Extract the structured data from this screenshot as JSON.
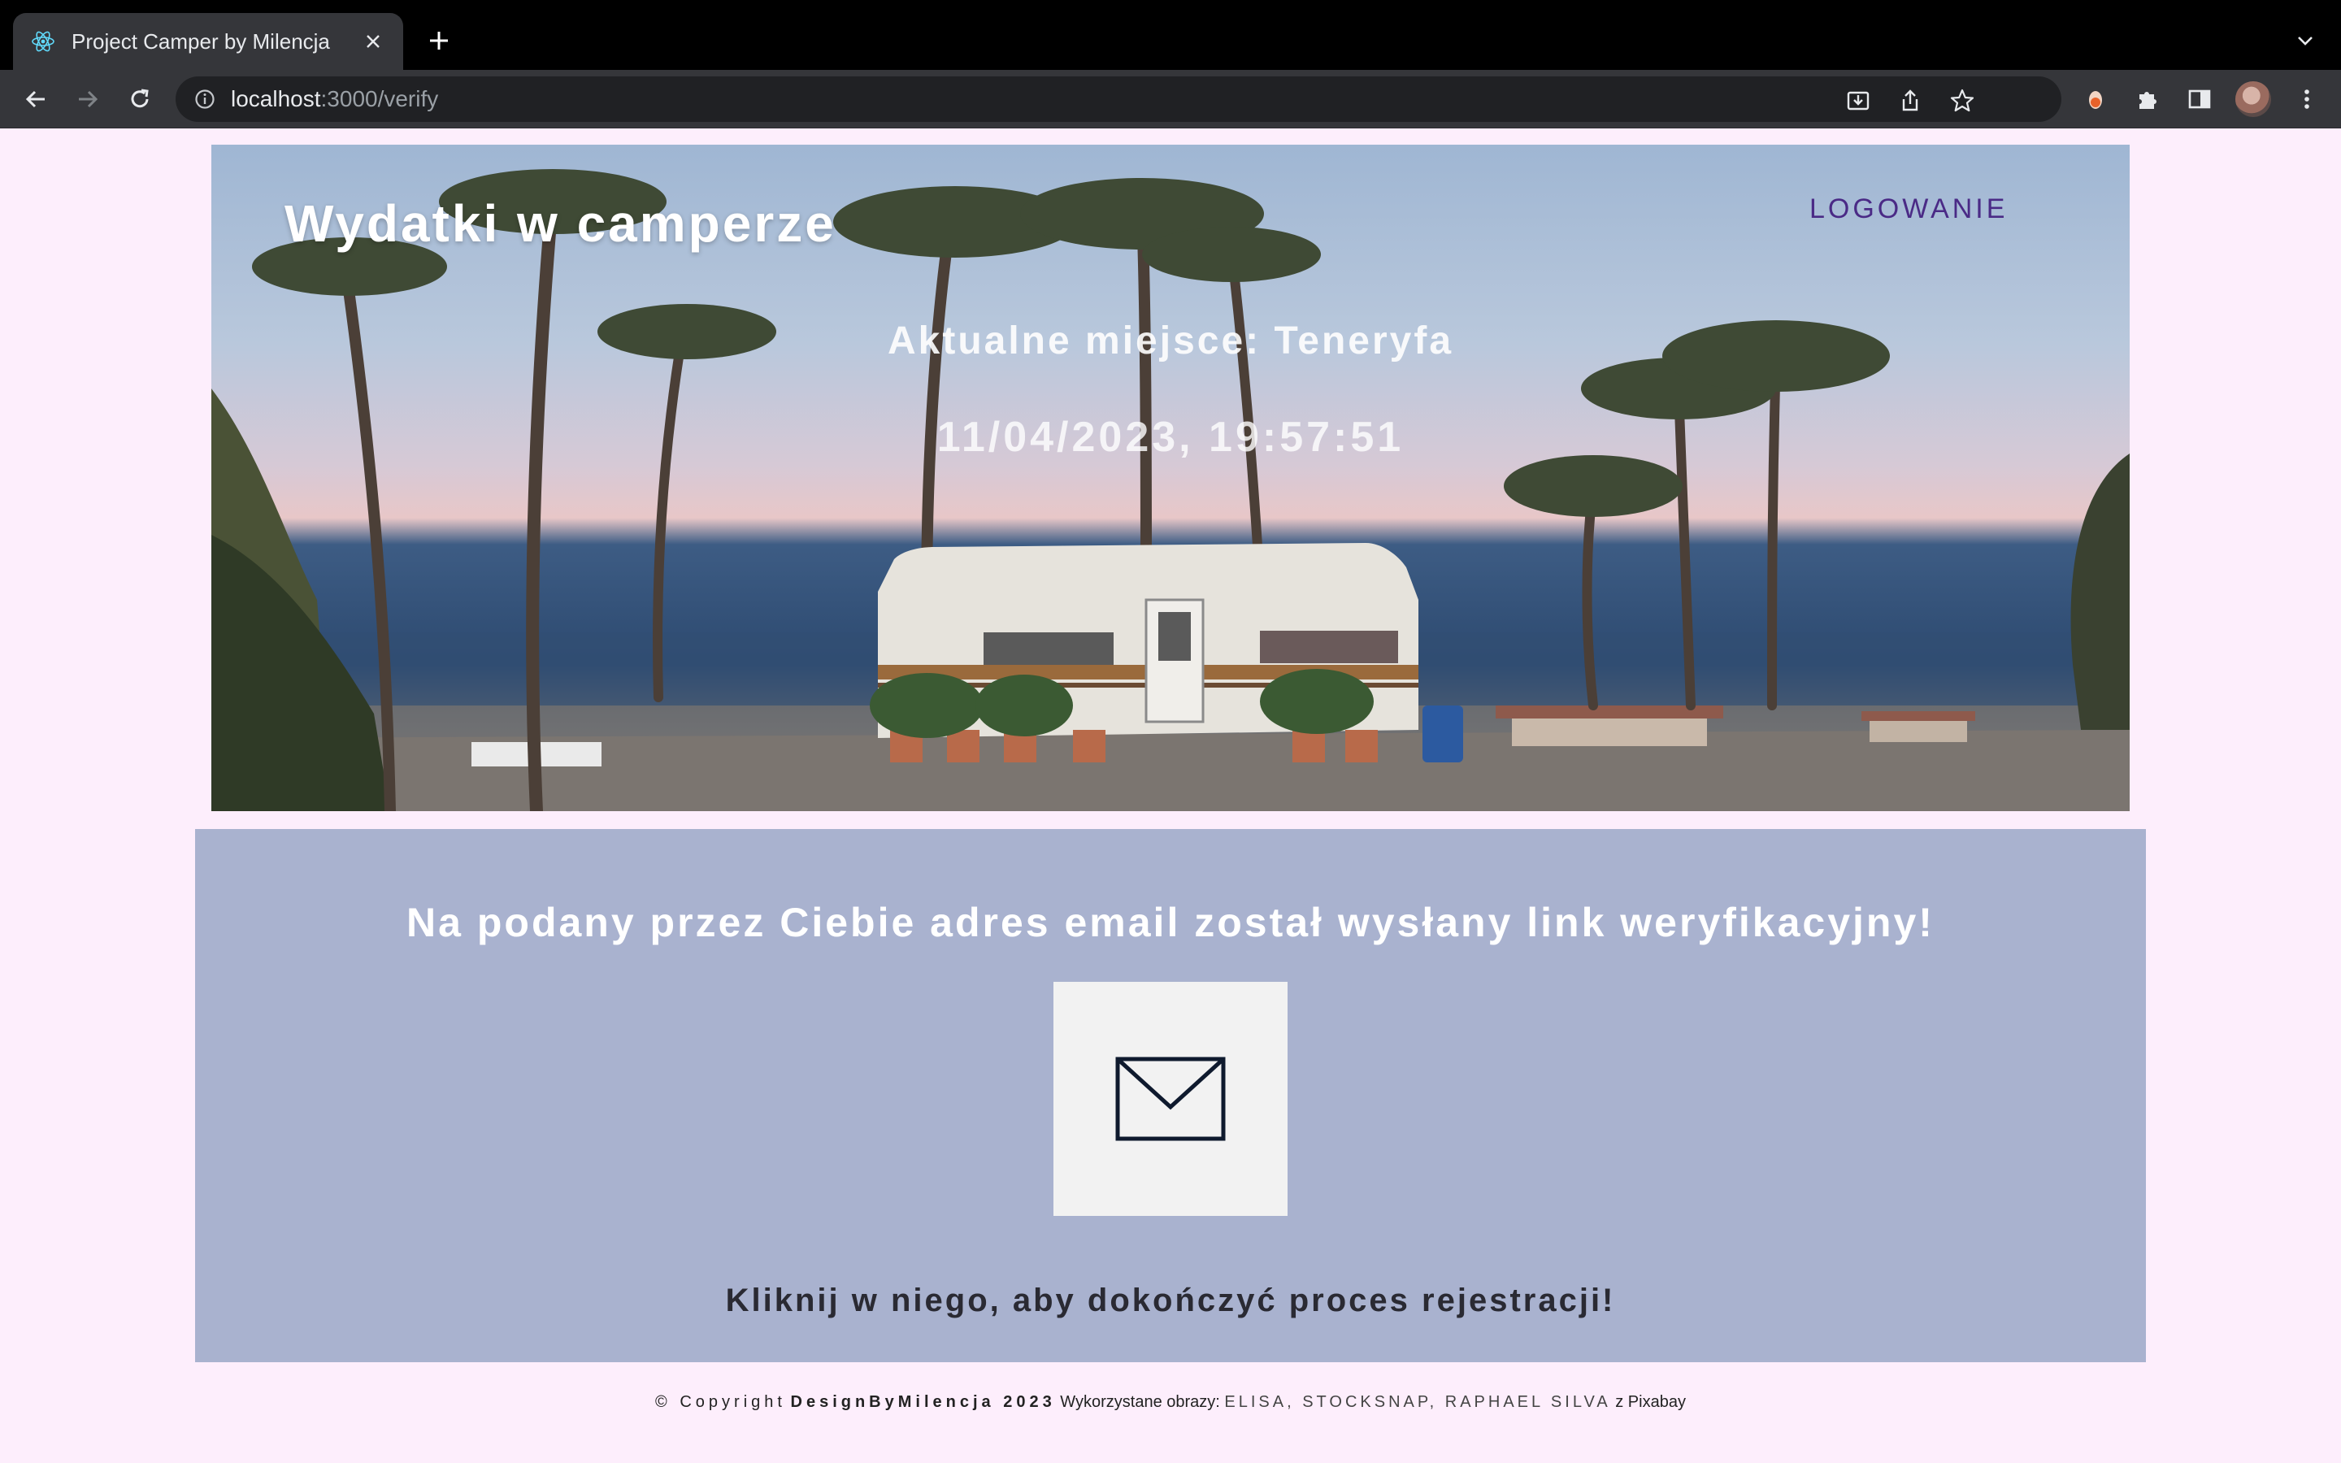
{
  "browser": {
    "tab_title": "Project Camper by Milencja",
    "url_host": "localhost",
    "url_rest": ":3000/verify"
  },
  "header": {
    "title": "Wydatki w camperze",
    "login_label": "LOGOWANIE",
    "place": "Aktualne miejsce: Teneryfa",
    "datetime": "11/04/2023, 19:57:51"
  },
  "verify": {
    "heading": "Na podany przez Ciebie adres email został wysłany link weryfikacyjny!",
    "icon": "envelope-icon",
    "subtext": "Kliknij w niego, aby dokończyć proces rejestracji!"
  },
  "footer": {
    "copyright": "© Copyright",
    "brand": "DesignByMilencja 2023",
    "images_prefix": "Wykorzystane obrazy:",
    "credits": "ELISA, STOCKSNAP, RAPHAEL SILVA",
    "source_prefix": "z",
    "source": "Pixabay"
  },
  "colors": {
    "page_bg": "#fdeefc",
    "panel_bg": "#a9b2cf",
    "login_link": "#4a2a86"
  }
}
